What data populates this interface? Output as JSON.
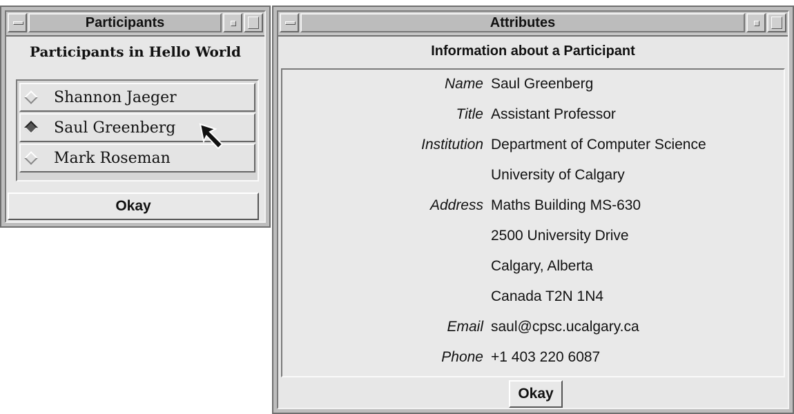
{
  "participants_window": {
    "title": "Participants",
    "heading": "Participants in Hello World",
    "participants": [
      {
        "name": "Shannon Jaeger",
        "selected": false
      },
      {
        "name": "Saul Greenberg",
        "selected": true
      },
      {
        "name": "Mark Roseman",
        "selected": false
      }
    ],
    "okay_label": "Okay"
  },
  "attributes_window": {
    "title": "Attributes",
    "heading": "Information about a Participant",
    "rows": [
      {
        "label": "Name",
        "value": "Saul Greenberg"
      },
      {
        "label": "Title",
        "value": "Assistant Professor"
      },
      {
        "label": "Institution",
        "value": "Department of Computer Science"
      },
      {
        "label": "",
        "value": "University of Calgary"
      },
      {
        "label": "Address",
        "value": "Maths Building MS-630"
      },
      {
        "label": "",
        "value": "2500 University Drive"
      },
      {
        "label": "",
        "value": "Calgary, Alberta"
      },
      {
        "label": "",
        "value": "Canada T2N 1N4"
      },
      {
        "label": "Email",
        "value": "saul@cpsc.ucalgary.ca"
      },
      {
        "label": "Phone",
        "value": "+1 403 220 6087"
      }
    ],
    "okay_label": "Okay"
  },
  "icons": {
    "window_menu": "window-menu-icon",
    "minimize": "minimize-icon",
    "maximize": "maximize-icon",
    "radio": "radio-diamond-icon",
    "cursor": "mouse-pointer-icon"
  },
  "colors": {
    "frame": "#bdbdbd",
    "panel": "#e7e7e7",
    "radio_selected": "#555555"
  }
}
